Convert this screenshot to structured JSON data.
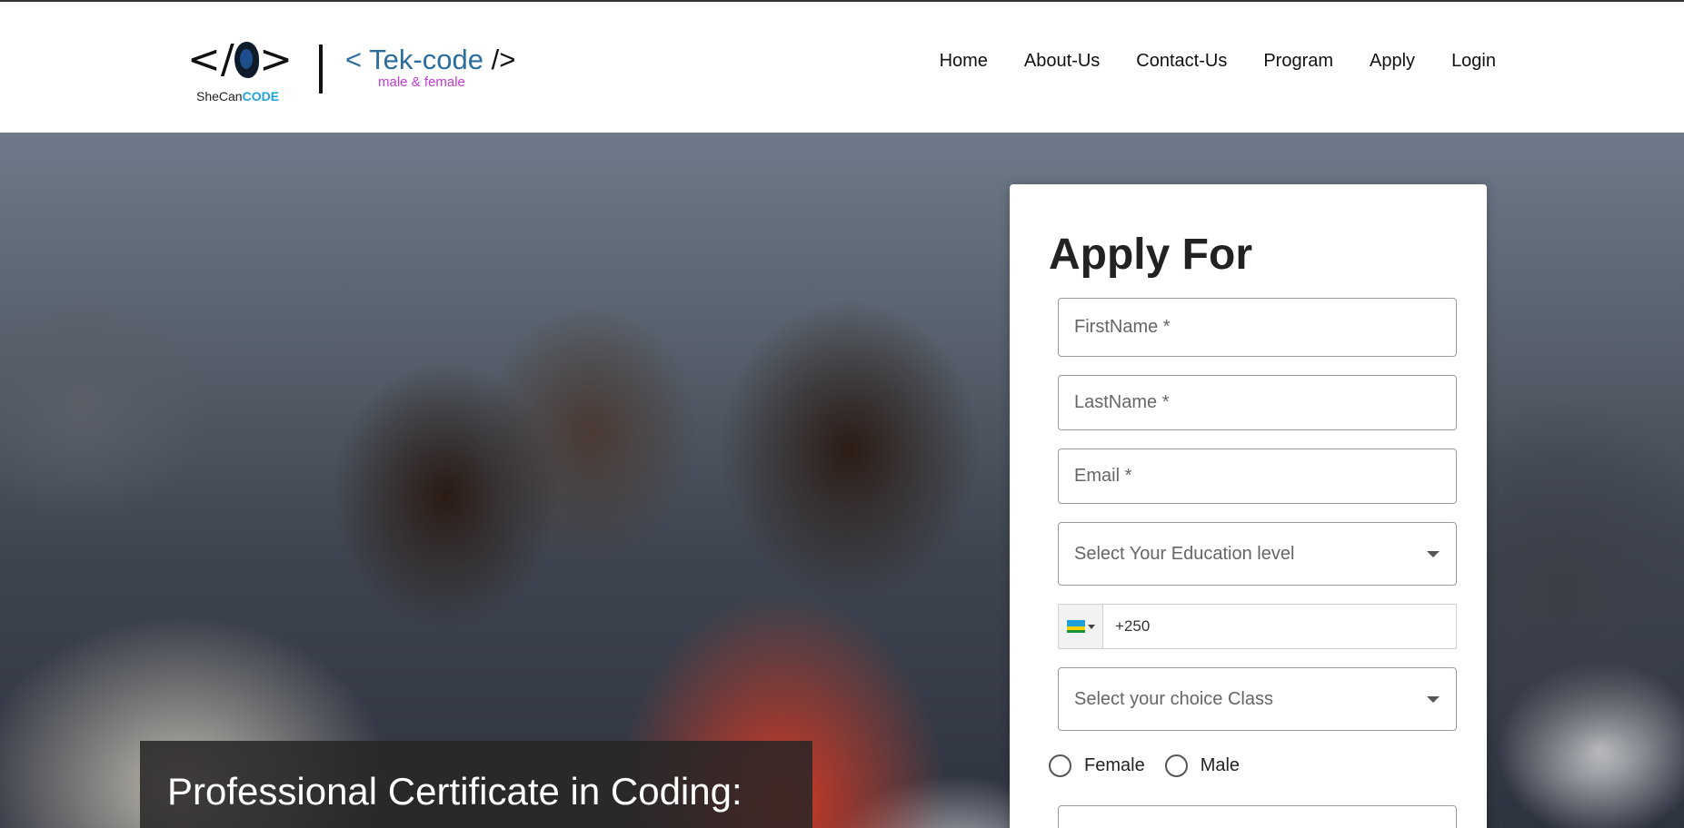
{
  "header": {
    "logo_primary": {
      "mark": "</ >",
      "caption_prefix": "SheCan",
      "caption_highlight": "CODE"
    },
    "logo_secondary": {
      "open": "<",
      "name": "Tek-code",
      "close": "/>",
      "tagline": "male & female"
    },
    "nav": [
      {
        "label": "Home"
      },
      {
        "label": "About-Us"
      },
      {
        "label": "Contact-Us"
      },
      {
        "label": "Program"
      },
      {
        "label": "Apply"
      },
      {
        "label": "Login"
      }
    ]
  },
  "hero": {
    "caption": "Professional Certificate in Coding:"
  },
  "form": {
    "title": "Apply For",
    "first_name_placeholder": "FirstName *",
    "last_name_placeholder": "LastName *",
    "email_placeholder": "Email *",
    "education_select": "Select Your Education level",
    "phone_value": "+250",
    "phone_flag": "rwanda-flag",
    "class_select": "Select your choice Class",
    "gender_options": [
      "Female",
      "Male"
    ]
  },
  "colors": {
    "brand_blue": "#2c6e9e",
    "code_cyan": "#1fa3e0",
    "tagline_magenta": "#c43ad8"
  }
}
